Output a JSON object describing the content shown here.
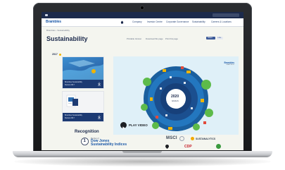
{
  "utility_bar": {
    "links": [
      "",
      "",
      ""
    ]
  },
  "nav": {
    "logo": "Brambles",
    "items": [
      "Company",
      "Investor Centre",
      "Corporate Governance",
      "Sustainability",
      "Careers & Locations"
    ]
  },
  "breadcrumb": "Brambles  ›  Sustainability",
  "page": {
    "title": "Sustainability",
    "year": "2017"
  },
  "tools": {
    "links": [
      "Printable Version",
      "Download this page",
      "Print this page"
    ],
    "share_label": "Share",
    "like_label": "Like"
  },
  "reports": [
    {
      "caption_line1": "Brambles Sustainability",
      "caption_line2": "Review 2017"
    },
    {
      "caption_line1": "Brambles Sustainability",
      "caption_line2": "Review 2017"
    }
  ],
  "video": {
    "brand": "Brambles",
    "brand_sub": "CHEP  IFCO",
    "center_year": "2020",
    "center_text": "GOALS",
    "play_label": "PLAY VIDEO"
  },
  "recognition": {
    "title": "Recognition",
    "dj_number": "1",
    "dj_sub": "Member of",
    "dj_name_line1": "Dow Jones",
    "dj_name_line2": "Sustainability Indices",
    "partners": {
      "msci": "MSCI",
      "sustainalytics": "SUSTAINALYTICS",
      "cdp": "CDP"
    }
  },
  "colors": {
    "navy": "#1c2a4c",
    "brand_blue": "#1e5aa8",
    "accent_yellow": "#f0b400",
    "cdp_red": "#c7202a"
  }
}
